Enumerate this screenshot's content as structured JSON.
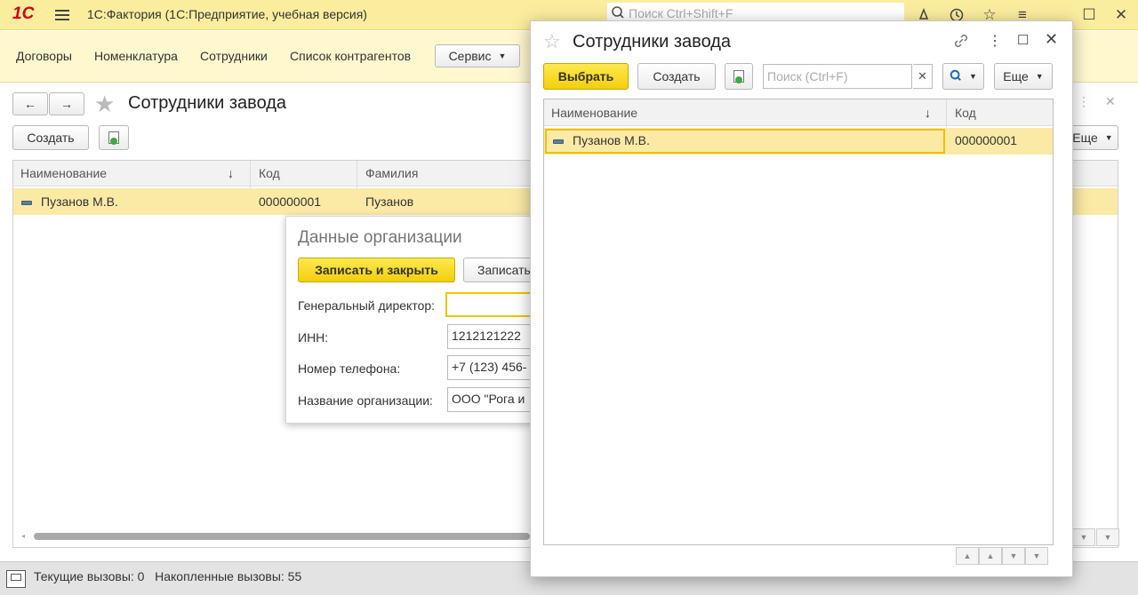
{
  "app": {
    "logo": "1С",
    "title": "1С:Фактория  (1С:Предприятие, учебная версия)",
    "search_placeholder": "Поиск Ctrl+Shift+F"
  },
  "nav": {
    "items": [
      "Договоры",
      "Номенклатура",
      "Сотрудники",
      "Список контрагентов"
    ],
    "service": "Сервис"
  },
  "bg_form": {
    "title": "Сотрудники завода",
    "create": "Создать",
    "more": "Еще",
    "columns": [
      "Наименование",
      "Код",
      "Фамилия"
    ],
    "row": {
      "name": "Пузанов М.В.",
      "code": "000000001",
      "surname": "Пузанов"
    }
  },
  "org_popup": {
    "title": "Данные организации",
    "save_close": "Записать и закрыть",
    "save": "Записать",
    "fields": [
      {
        "label": "Генеральный директор:",
        "value": ""
      },
      {
        "label": "ИНН:",
        "value": "1212121222"
      },
      {
        "label": "Номер телефона:",
        "value": "+7 (123) 456-"
      },
      {
        "label": "Название организации:",
        "value": "ООО \"Рога и"
      }
    ]
  },
  "modal": {
    "title": "Сотрудники завода",
    "select": "Выбрать",
    "create": "Создать",
    "search_placeholder": "Поиск (Ctrl+F)",
    "more": "Еще",
    "columns": [
      "Наименование",
      "Код"
    ],
    "rows": [
      {
        "name": "Пузанов М.В.",
        "code": "000000001"
      }
    ]
  },
  "status": {
    "text": "Текущие вызовы: 0   Накопленные вызовы: 55"
  }
}
